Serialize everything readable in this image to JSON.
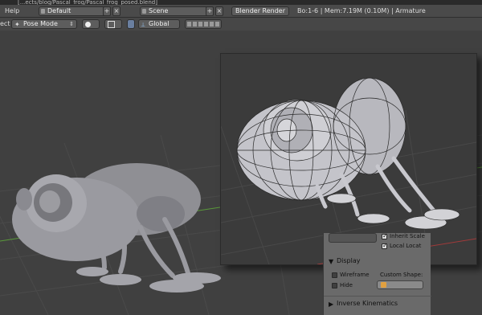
{
  "titlebar": {
    "text": "[...ects/blog/Pascal_frog/Pascal_frog_posed.blend]"
  },
  "infobar": {
    "help_label": "Help",
    "layout_value": "Default",
    "scene_value": "Scene",
    "render_engine": "Blender Render",
    "stats": "Bo:1-6 | Mem:7.19M (0.10M) | Armature"
  },
  "toolbar": {
    "left_label": "ect",
    "mode_value": "Pose Mode",
    "orientation_value": "Global"
  },
  "panel": {
    "inherit_scale_label": "Inherit Scale",
    "local_location_label": "Local Locat",
    "display_header": "Display",
    "wireframe_label": "Wireframe",
    "custom_shape_label": "Custom Shape:",
    "hide_label": "Hide",
    "ik_header": "Inverse Kinematics"
  },
  "colors": {
    "accent_green": "#5a9a3a",
    "accent_red": "#a03a3a"
  }
}
